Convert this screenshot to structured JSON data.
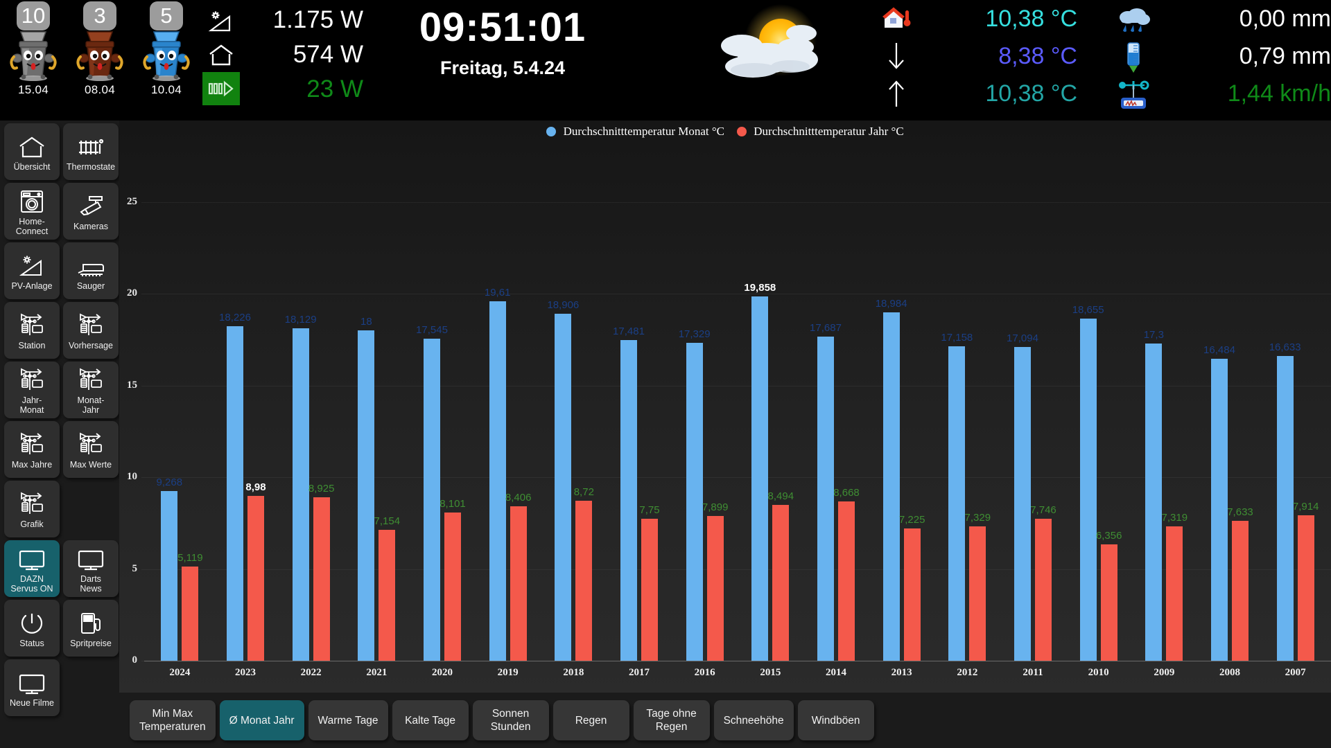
{
  "topbar": {
    "bins": [
      {
        "badge": "10",
        "date": "15.04",
        "color": "#8a8a8a",
        "name": "grey-bin"
      },
      {
        "badge": "3",
        "date": "08.04",
        "color": "#7a2f14",
        "name": "brown-bin"
      },
      {
        "badge": "5",
        "date": "10.04",
        "color": "#2f93e0",
        "name": "blue-bin"
      }
    ],
    "power": {
      "icons": [
        "solar-panel-icon",
        "house-icon",
        "battery-flow-icon"
      ],
      "values": [
        {
          "text": "1.175 W",
          "color": "#ffffff"
        },
        {
          "text": "574 W",
          "color": "#ffffff"
        },
        {
          "text": "23 W",
          "color": "#0f8a18"
        }
      ]
    },
    "clock": {
      "time": "09:51:01",
      "date": "Freitag, 5.4.24"
    },
    "weather_icon": "sun-behind-cloud-icon",
    "temperatures": {
      "icons": [
        "house-thermometer-icon",
        "arrow-down-icon",
        "arrow-up-icon"
      ],
      "values": [
        {
          "text": "10,38 °C",
          "color": "#36e0e0"
        },
        {
          "text": "8,38 °C",
          "color": "#5b5bff"
        },
        {
          "text": "10,38 °C",
          "color": "#23a6a6"
        }
      ]
    },
    "precipitation": {
      "icons": [
        "rain-cloud-icon",
        "rain-gauge-icon",
        "anemometer-icon"
      ],
      "values": [
        {
          "text": "0,00 mm",
          "color": "#ffffff"
        },
        {
          "text": "0,79 mm",
          "color": "#ffffff"
        },
        {
          "text": "1,44 km/h",
          "color": "#0f8a18"
        }
      ]
    }
  },
  "sidebar": {
    "items": [
      {
        "label": "Übersicht",
        "icon": "house-icon",
        "active": false
      },
      {
        "label": "Thermostate",
        "icon": "radiator-icon",
        "active": false
      },
      {
        "label": "Home-\nConnect",
        "icon": "washing-machine-icon",
        "active": false
      },
      {
        "label": "Kameras",
        "icon": "cctv-camera-icon",
        "active": false
      },
      {
        "label": "PV-Anlage",
        "icon": "solar-panel-icon",
        "active": false
      },
      {
        "label": "Sauger",
        "icon": "vacuum-robot-icon",
        "active": false
      },
      {
        "label": "Station",
        "icon": "weather-station-icon",
        "active": false
      },
      {
        "label": "Vorhersage",
        "icon": "weather-station-icon",
        "active": false
      },
      {
        "label": "Jahr-\nMonat",
        "icon": "weather-station-icon",
        "active": false
      },
      {
        "label": "Monat-\nJahr",
        "icon": "weather-station-icon",
        "active": false
      },
      {
        "label": "Max Jahre",
        "icon": "weather-station-icon",
        "active": false
      },
      {
        "label": "Max Werte",
        "icon": "weather-station-icon",
        "active": false
      },
      {
        "label": "Grafik",
        "icon": "weather-station-icon",
        "active": false
      },
      {
        "label": "",
        "icon": "spacer",
        "active": false
      },
      {
        "label": "DAZN\nServus ON",
        "icon": "monitor-icon",
        "active": true
      },
      {
        "label": "Darts\nNews",
        "icon": "monitor-icon",
        "active": false
      },
      {
        "label": "Status",
        "icon": "power-icon",
        "active": false
      },
      {
        "label": "Spritpreise",
        "icon": "fuel-pump-icon",
        "active": false
      },
      {
        "label": "Neue Filme",
        "icon": "monitor-icon",
        "active": false
      }
    ]
  },
  "chart_data": {
    "type": "bar",
    "title": "",
    "xlabel": "",
    "ylabel": "",
    "ylim": [
      0,
      25
    ],
    "yticks": [
      0,
      5,
      10,
      15,
      20,
      25
    ],
    "grid": true,
    "legend_position": "top-center",
    "colors": {
      "monat": "#68b3ef",
      "jahr": "#f4594b",
      "label_blue": "#1b3f85",
      "label_green": "#3f8e33",
      "label_max": "#ffffff"
    },
    "categories": [
      "2024",
      "2023",
      "2022",
      "2021",
      "2020",
      "2019",
      "2018",
      "2017",
      "2016",
      "2015",
      "2014",
      "2013",
      "2012",
      "2011",
      "2010",
      "2009",
      "2008",
      "2007"
    ],
    "series": [
      {
        "name": "Durchschnitttemperatur Monat °C",
        "color": "#68b3ef",
        "values": [
          9.268,
          18.226,
          18.129,
          18,
          17.545,
          19.61,
          18.906,
          17.481,
          17.329,
          19.858,
          17.687,
          18.984,
          17.158,
          17.094,
          18.655,
          17.3,
          16.484,
          16.633
        ],
        "labels": [
          "9,268",
          "18,226",
          "18,129",
          "18",
          "17,545",
          "19,61",
          "18,906",
          "17,481",
          "17,329",
          "19,858",
          "17,687",
          "18,984",
          "17,158",
          "17,094",
          "18,655",
          "17,3",
          "16,484",
          "16,633"
        ],
        "label_colors": [
          "#1b3f85",
          "#1b3f85",
          "#1b3f85",
          "#1b3f85",
          "#1b3f85",
          "#1b3f85",
          "#1b3f85",
          "#1b3f85",
          "#1b3f85",
          "#ffffff",
          "#1b3f85",
          "#1b3f85",
          "#1b3f85",
          "#1b3f85",
          "#1b3f85",
          "#1b3f85",
          "#1b3f85",
          "#1b3f85"
        ]
      },
      {
        "name": "Durchschnitttemperatur Jahr °C",
        "color": "#f4594b",
        "values": [
          5.119,
          8.98,
          8.925,
          7.154,
          8.101,
          8.406,
          8.72,
          7.75,
          7.899,
          8.494,
          8.668,
          7.225,
          7.329,
          7.746,
          6.356,
          7.319,
          7.633,
          7.914
        ],
        "labels": [
          "5,119",
          "8,98",
          "8,925",
          "7,154",
          "8,101",
          "8,406",
          "8,72",
          "7,75",
          "7,899",
          "8,494",
          "8,668",
          "7,225",
          "7,329",
          "7,746",
          "6,356",
          "7,319",
          "7,633",
          "7,914"
        ],
        "label_colors": [
          "#3f8e33",
          "#ffffff",
          "#3f8e33",
          "#3f8e33",
          "#3f8e33",
          "#3f8e33",
          "#3f8e33",
          "#3f8e33",
          "#3f8e33",
          "#3f8e33",
          "#3f8e33",
          "#3f8e33",
          "#3f8e33",
          "#3f8e33",
          "#3f8e33",
          "#3f8e33",
          "#3f8e33",
          "#3f8e33"
        ]
      }
    ]
  },
  "bottom_buttons": [
    {
      "label": "Min Max\nTemperaturen",
      "active": false
    },
    {
      "label": "Ø Monat Jahr",
      "active": true
    },
    {
      "label": "Warme Tage",
      "active": false
    },
    {
      "label": "Kalte Tage",
      "active": false
    },
    {
      "label": "Sonnen\nStunden",
      "active": false
    },
    {
      "label": "Regen",
      "active": false
    },
    {
      "label": "Tage ohne\nRegen",
      "active": false
    },
    {
      "label": "Schneehöhe",
      "active": false
    },
    {
      "label": "Windböen",
      "active": false
    }
  ]
}
